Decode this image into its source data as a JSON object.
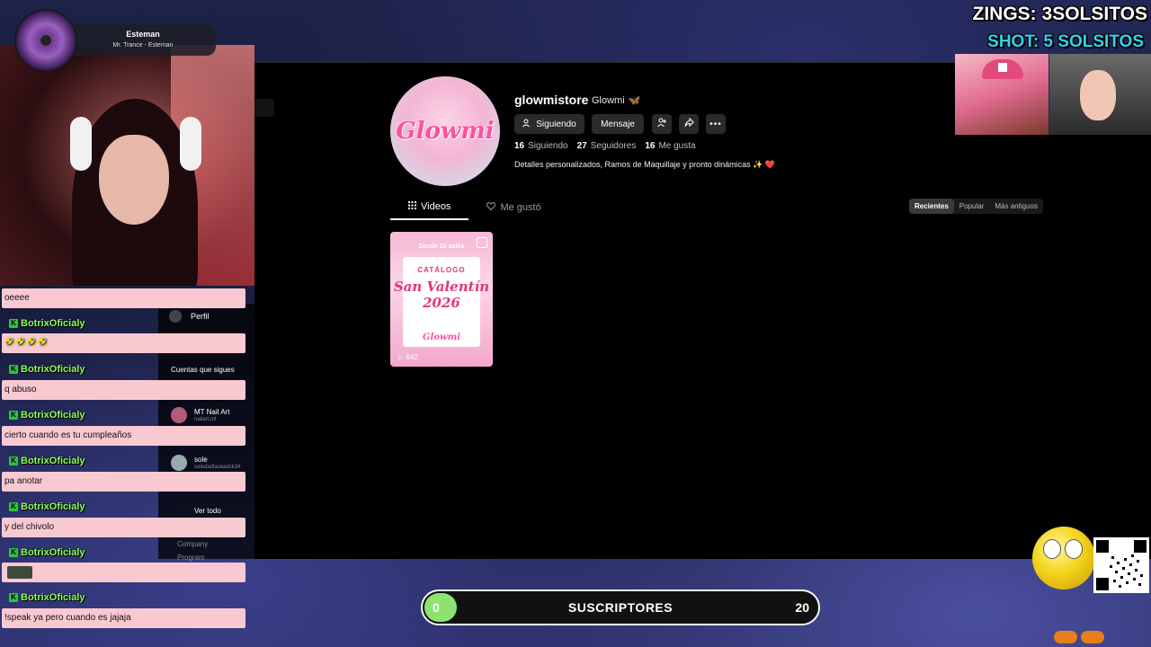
{
  "now_playing": {
    "artist": "Esteman",
    "track": "Mr. Trance - Esteman"
  },
  "overlay": {
    "zings": "ZINGS: 3SOLSITOS",
    "shot": "SHOT: 5 SOLSITOS"
  },
  "profile": {
    "avatar_text": "Glowmi",
    "username": "glowmistore",
    "nickname": "Glowmi",
    "nickname_emoji": "🦋",
    "buttons": {
      "following": "Siguiendo",
      "message": "Mensaje"
    },
    "stats": {
      "following_count": "16",
      "following_label": "Siguiendo",
      "followers_count": "27",
      "followers_label": "Seguidores",
      "likes_count": "16",
      "likes_label": "Me gusta"
    },
    "bio": "Detalles personalizados, Ramos de Maquillaje y pronto dinámicas ✨",
    "bio_heart": "❤️",
    "tabs": {
      "videos": "Videos",
      "liked": "Me gustó"
    },
    "sort": {
      "recent": "Recientes",
      "popular": "Popular",
      "oldest": "Más antiguos"
    },
    "videos": [
      {
        "top_text": "Desde 10 soles",
        "title1": "CATÁLOGO",
        "title2": "San Valentín 2026",
        "brand": "Glowmi",
        "views": "642"
      }
    ]
  },
  "sidebar": {
    "profile": "Perfil",
    "following_header": "Cuentas que sigues",
    "accounts": [
      {
        "name": "MT Nail Art",
        "handle": "nailart.mt"
      },
      {
        "name": "sole",
        "handle": "soledadlaceadck34"
      }
    ],
    "see_all": "Ver todo",
    "company": "Company",
    "program": "Program"
  },
  "chat": [
    {
      "user": "",
      "text": "oeeee"
    },
    {
      "user": "BotrixOficialy",
      "text": "🤣🤣🤣🤣"
    },
    {
      "user": "BotrixOficialy",
      "text": "q abuso"
    },
    {
      "user": "BotrixOficialy",
      "text": "cierto cuando es tu cumpleaños"
    },
    {
      "user": "BotrixOficialy",
      "text": "pa anotar"
    },
    {
      "user": "BotrixOficialy",
      "text": "y del chivolo"
    },
    {
      "user": "BotrixOficialy",
      "text": ""
    },
    {
      "user": "BotrixOficialy",
      "text": "!speak ya pero cuando es jajaja"
    }
  ],
  "subscribers": {
    "current": "0",
    "label": "SUSCRIPTORES",
    "goal": "20",
    "progress": 0
  },
  "colors": {
    "chat_bg": "#f9c9d2",
    "chat_user": "#8cff5a",
    "shot": "#36d1f0",
    "sub_fill": "#8ee36f"
  }
}
